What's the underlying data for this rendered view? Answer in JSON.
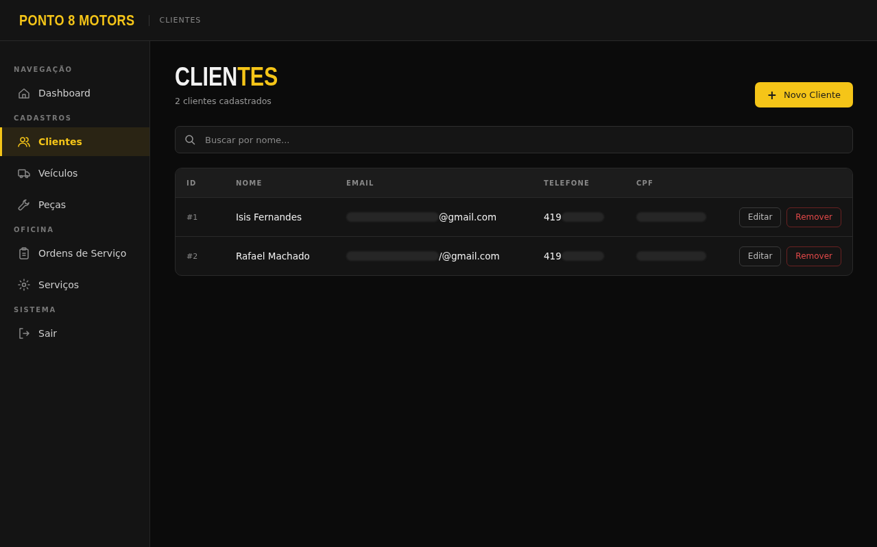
{
  "header": {
    "brand": "PONTO 8 MOTORS",
    "breadcrumb": "CLIENTES"
  },
  "sidebar": {
    "sections": [
      {
        "title": "NAVEGAÇÃO",
        "items": [
          {
            "label": "Dashboard",
            "selected": false
          }
        ]
      },
      {
        "title": "CADASTROS",
        "items": [
          {
            "label": "Clientes",
            "selected": true
          },
          {
            "label": "Veículos",
            "selected": false
          },
          {
            "label": "Peças",
            "selected": false
          }
        ]
      },
      {
        "title": "OFICINA",
        "items": [
          {
            "label": "Ordens de Serviço",
            "selected": false
          },
          {
            "label": "Serviços",
            "selected": false
          }
        ]
      },
      {
        "title": "SISTEMA",
        "items": [
          {
            "label": "Sair",
            "selected": false
          }
        ]
      }
    ]
  },
  "page": {
    "title": [
      {
        "text": "CLIEN",
        "highlight": false
      },
      {
        "text": "TES",
        "highlight": true
      }
    ],
    "subtitle": "2 clientes cadastrados",
    "new_button": {
      "icon": "+",
      "label": "Novo Cliente"
    }
  },
  "search": {
    "placeholder": "Buscar por nome..."
  },
  "table": {
    "columns": [
      "ID",
      "NOME",
      "EMAIL",
      "TELEFONE",
      "CPF"
    ],
    "rows": [
      {
        "id": "#1",
        "name": "Isis Fernandes",
        "email": {
          "text": "@gmail.com",
          "redacted": true
        },
        "phone": {
          "text": "419",
          "redacted": true
        },
        "cpf": {
          "redacted": true
        },
        "actions": [
          "Editar",
          "Remover"
        ]
      },
      {
        "id": "#2",
        "name": "Rafael Machado",
        "email": {
          "text": "/@gmail.com",
          "redacted": true
        },
        "phone": {
          "text": "419",
          "redacted": true
        },
        "cpf": {
          "redacted": true
        },
        "actions": [
          "Editar",
          "Remover"
        ]
      }
    ]
  }
}
